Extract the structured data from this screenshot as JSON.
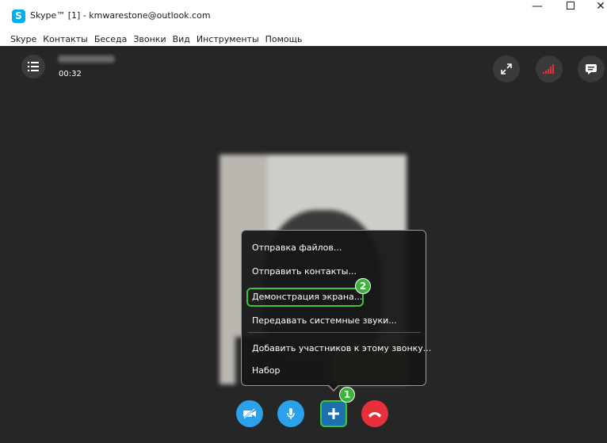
{
  "window": {
    "title": "Skype™ [1] - kmwarestone@outlook.com",
    "app_icon_letter": "S",
    "minimize_glyph": "—",
    "close_glyph": "✕"
  },
  "menu": {
    "items": [
      "Skype",
      "Контакты",
      "Беседа",
      "Звонки",
      "Вид",
      "Инструменты",
      "Помощь"
    ]
  },
  "call": {
    "timer": "00:32"
  },
  "popup": {
    "items": [
      "Отправка файлов...",
      "Отправить контакты...",
      "Демонстрация экрана...",
      "Передавать системные звуки...",
      "Добавить участников к этому звонку...",
      "Набор"
    ]
  },
  "annotations": {
    "badge_1": "1",
    "badge_2": "2"
  },
  "icons": {
    "list": "list-icon",
    "expand": "expand-icon",
    "signal": "signal-icon",
    "chat": "chat-icon",
    "video_off": "video-off-icon",
    "mic": "microphone-icon",
    "add": "plus-icon",
    "hangup": "hang-up-icon"
  },
  "colors": {
    "skype_blue": "#00aff0",
    "call_background": "#262626",
    "control_blue": "#2aa1e8",
    "hangup_red": "#e8303a",
    "highlight_green": "#39c63a",
    "signal_red": "#e0323a"
  }
}
